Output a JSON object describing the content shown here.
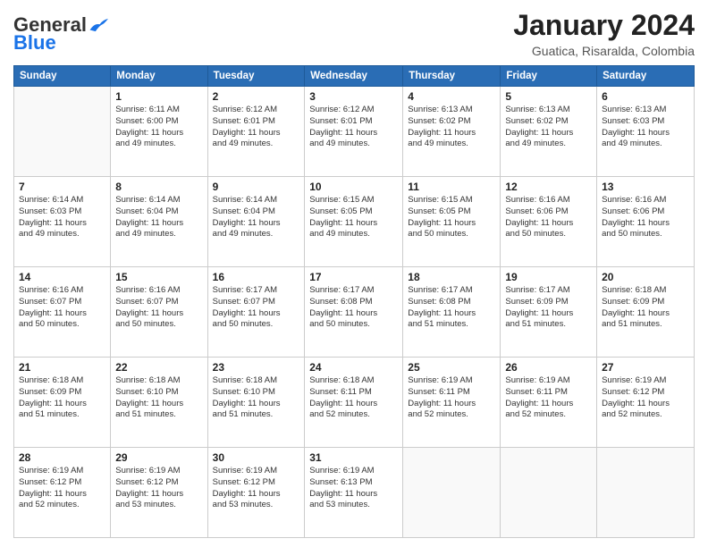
{
  "header": {
    "logo_general": "General",
    "logo_blue": "Blue",
    "title": "January 2024",
    "subtitle": "Guatica, Risaralda, Colombia"
  },
  "weekdays": [
    "Sunday",
    "Monday",
    "Tuesday",
    "Wednesday",
    "Thursday",
    "Friday",
    "Saturday"
  ],
  "weeks": [
    [
      {
        "day": "",
        "info": ""
      },
      {
        "day": "1",
        "info": "Sunrise: 6:11 AM\nSunset: 6:00 PM\nDaylight: 11 hours\nand 49 minutes."
      },
      {
        "day": "2",
        "info": "Sunrise: 6:12 AM\nSunset: 6:01 PM\nDaylight: 11 hours\nand 49 minutes."
      },
      {
        "day": "3",
        "info": "Sunrise: 6:12 AM\nSunset: 6:01 PM\nDaylight: 11 hours\nand 49 minutes."
      },
      {
        "day": "4",
        "info": "Sunrise: 6:13 AM\nSunset: 6:02 PM\nDaylight: 11 hours\nand 49 minutes."
      },
      {
        "day": "5",
        "info": "Sunrise: 6:13 AM\nSunset: 6:02 PM\nDaylight: 11 hours\nand 49 minutes."
      },
      {
        "day": "6",
        "info": "Sunrise: 6:13 AM\nSunset: 6:03 PM\nDaylight: 11 hours\nand 49 minutes."
      }
    ],
    [
      {
        "day": "7",
        "info": "Sunrise: 6:14 AM\nSunset: 6:03 PM\nDaylight: 11 hours\nand 49 minutes."
      },
      {
        "day": "8",
        "info": "Sunrise: 6:14 AM\nSunset: 6:04 PM\nDaylight: 11 hours\nand 49 minutes."
      },
      {
        "day": "9",
        "info": "Sunrise: 6:14 AM\nSunset: 6:04 PM\nDaylight: 11 hours\nand 49 minutes."
      },
      {
        "day": "10",
        "info": "Sunrise: 6:15 AM\nSunset: 6:05 PM\nDaylight: 11 hours\nand 49 minutes."
      },
      {
        "day": "11",
        "info": "Sunrise: 6:15 AM\nSunset: 6:05 PM\nDaylight: 11 hours\nand 50 minutes."
      },
      {
        "day": "12",
        "info": "Sunrise: 6:16 AM\nSunset: 6:06 PM\nDaylight: 11 hours\nand 50 minutes."
      },
      {
        "day": "13",
        "info": "Sunrise: 6:16 AM\nSunset: 6:06 PM\nDaylight: 11 hours\nand 50 minutes."
      }
    ],
    [
      {
        "day": "14",
        "info": "Sunrise: 6:16 AM\nSunset: 6:07 PM\nDaylight: 11 hours\nand 50 minutes."
      },
      {
        "day": "15",
        "info": "Sunrise: 6:16 AM\nSunset: 6:07 PM\nDaylight: 11 hours\nand 50 minutes."
      },
      {
        "day": "16",
        "info": "Sunrise: 6:17 AM\nSunset: 6:07 PM\nDaylight: 11 hours\nand 50 minutes."
      },
      {
        "day": "17",
        "info": "Sunrise: 6:17 AM\nSunset: 6:08 PM\nDaylight: 11 hours\nand 50 minutes."
      },
      {
        "day": "18",
        "info": "Sunrise: 6:17 AM\nSunset: 6:08 PM\nDaylight: 11 hours\nand 51 minutes."
      },
      {
        "day": "19",
        "info": "Sunrise: 6:17 AM\nSunset: 6:09 PM\nDaylight: 11 hours\nand 51 minutes."
      },
      {
        "day": "20",
        "info": "Sunrise: 6:18 AM\nSunset: 6:09 PM\nDaylight: 11 hours\nand 51 minutes."
      }
    ],
    [
      {
        "day": "21",
        "info": "Sunrise: 6:18 AM\nSunset: 6:09 PM\nDaylight: 11 hours\nand 51 minutes."
      },
      {
        "day": "22",
        "info": "Sunrise: 6:18 AM\nSunset: 6:10 PM\nDaylight: 11 hours\nand 51 minutes."
      },
      {
        "day": "23",
        "info": "Sunrise: 6:18 AM\nSunset: 6:10 PM\nDaylight: 11 hours\nand 51 minutes."
      },
      {
        "day": "24",
        "info": "Sunrise: 6:18 AM\nSunset: 6:11 PM\nDaylight: 11 hours\nand 52 minutes."
      },
      {
        "day": "25",
        "info": "Sunrise: 6:19 AM\nSunset: 6:11 PM\nDaylight: 11 hours\nand 52 minutes."
      },
      {
        "day": "26",
        "info": "Sunrise: 6:19 AM\nSunset: 6:11 PM\nDaylight: 11 hours\nand 52 minutes."
      },
      {
        "day": "27",
        "info": "Sunrise: 6:19 AM\nSunset: 6:12 PM\nDaylight: 11 hours\nand 52 minutes."
      }
    ],
    [
      {
        "day": "28",
        "info": "Sunrise: 6:19 AM\nSunset: 6:12 PM\nDaylight: 11 hours\nand 52 minutes."
      },
      {
        "day": "29",
        "info": "Sunrise: 6:19 AM\nSunset: 6:12 PM\nDaylight: 11 hours\nand 53 minutes."
      },
      {
        "day": "30",
        "info": "Sunrise: 6:19 AM\nSunset: 6:12 PM\nDaylight: 11 hours\nand 53 minutes."
      },
      {
        "day": "31",
        "info": "Sunrise: 6:19 AM\nSunset: 6:13 PM\nDaylight: 11 hours\nand 53 minutes."
      },
      {
        "day": "",
        "info": ""
      },
      {
        "day": "",
        "info": ""
      },
      {
        "day": "",
        "info": ""
      }
    ]
  ]
}
